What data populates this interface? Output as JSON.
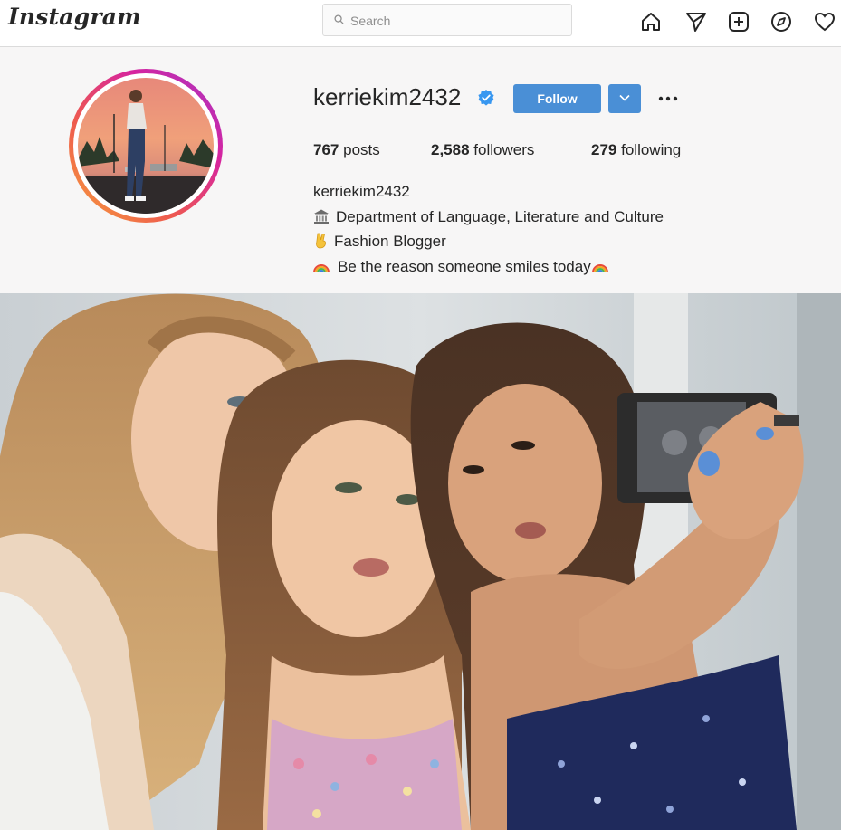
{
  "nav": {
    "logo": "Instagram",
    "search_placeholder": "Search",
    "icons": [
      "home-icon",
      "direct-send-icon",
      "new-post-icon",
      "explore-icon",
      "activity-heart-icon"
    ]
  },
  "profile": {
    "username": "kerriekim2432",
    "verified": true,
    "follow_label": "Follow",
    "stats": {
      "posts_count": "767",
      "posts_label": "posts",
      "followers_count": "2,588",
      "followers_label": "followers",
      "following_count": "279",
      "following_label": "following"
    },
    "bio": {
      "name": "kerriekim2432",
      "line1": "Department of Language, Literature and Culture",
      "line2": "Fashion Blogger",
      "line3": "Be the reason someone smiles today"
    }
  },
  "colors": {
    "accent": "#4a8fd6",
    "verified": "#3897f0",
    "text": "#262626"
  }
}
